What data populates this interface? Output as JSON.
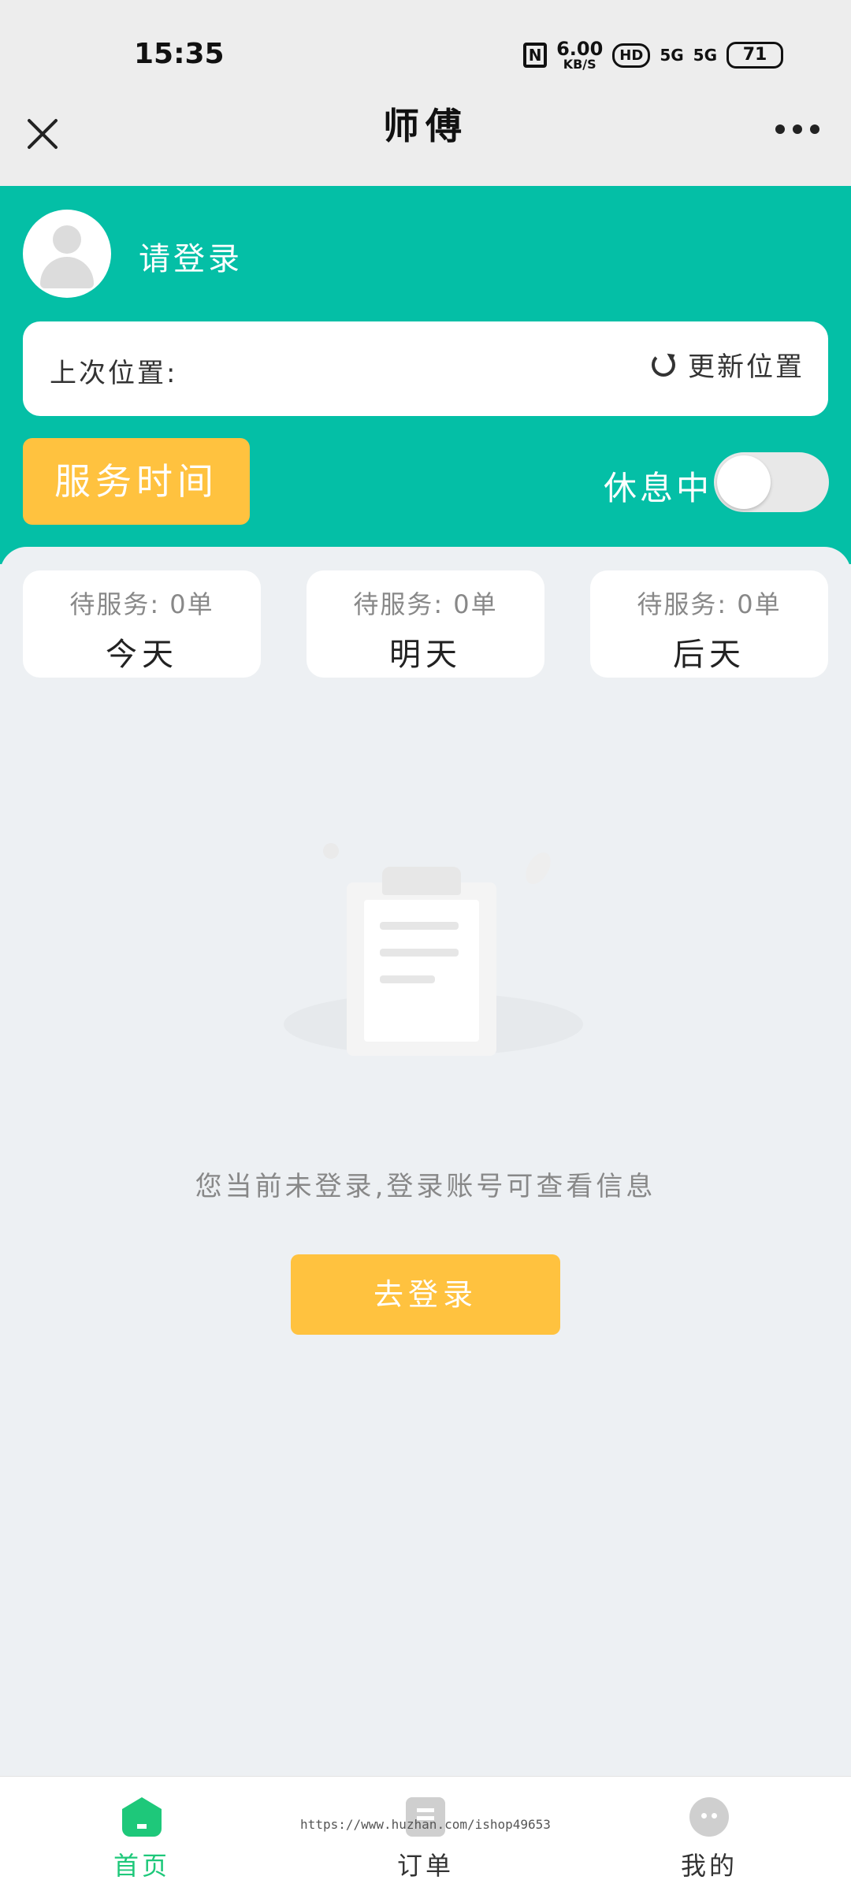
{
  "status_bar": {
    "time": "15:35",
    "nfc": "N",
    "speed_value": "6.00",
    "speed_unit": "KB/S",
    "hd": "HD",
    "net1": "5G",
    "net2": "5G",
    "battery": "71"
  },
  "titlebar": {
    "title": "师傅"
  },
  "header": {
    "login_prompt": "请登录",
    "location_label": "上次位置:",
    "refresh_label": "更新位置",
    "service_time_label": "服务时间",
    "rest_label": "休息中",
    "toggle_on": false
  },
  "days": [
    {
      "pending": "待服务: 0单",
      "day": "今天"
    },
    {
      "pending": "待服务: 0单",
      "day": "明天"
    },
    {
      "pending": "待服务: 0单",
      "day": "后天"
    }
  ],
  "empty_state": {
    "message": "您当前未登录,登录账号可查看信息",
    "button_label": "去登录"
  },
  "nav": {
    "items": [
      {
        "label": "首页",
        "icon": "home-icon",
        "active": true,
        "color": "#1ec87a"
      },
      {
        "label": "订单",
        "icon": "order-icon",
        "active": false,
        "color": "#333333"
      },
      {
        "label": "我的",
        "icon": "profile-icon",
        "active": false,
        "color": "#333333"
      }
    ]
  },
  "watermark": "https://www.huzhan.com/ishop49653",
  "colors": {
    "brand_green": "#04bfa6",
    "accent_yellow": "#ffc23f",
    "active_nav": "#1ec87a"
  }
}
